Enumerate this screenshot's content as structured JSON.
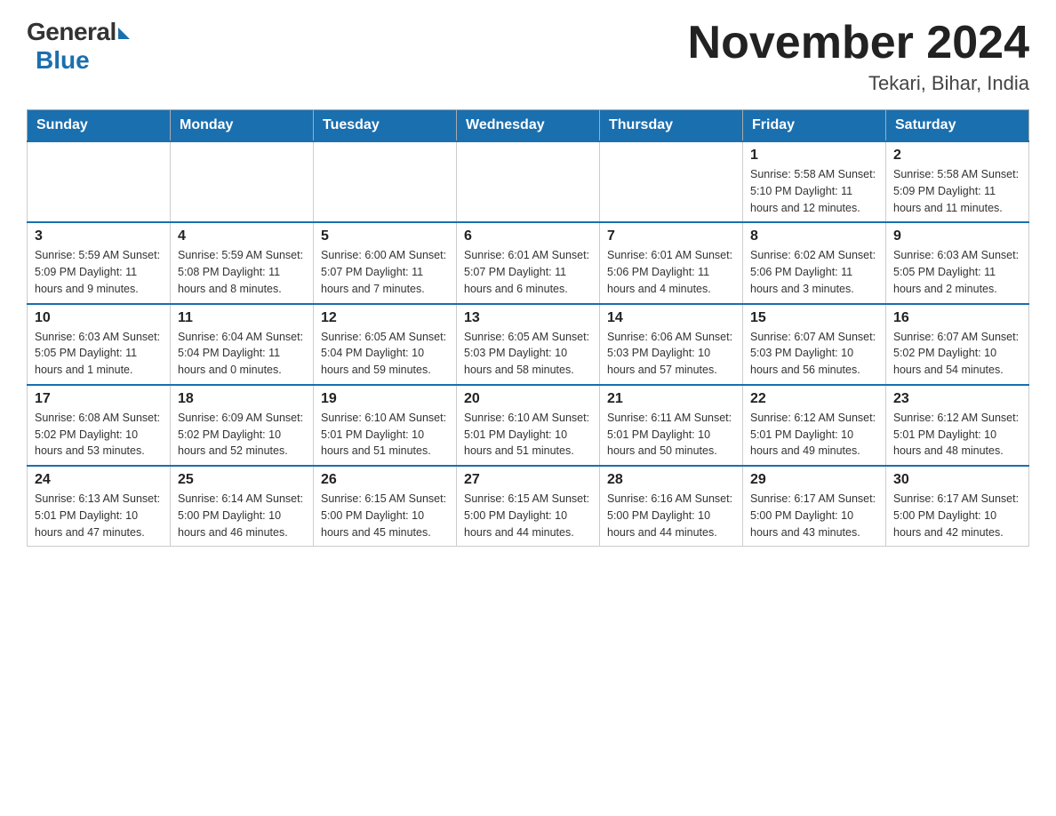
{
  "logo": {
    "general": "General",
    "triangle": "▶",
    "blue": "Blue"
  },
  "title": {
    "month_year": "November 2024",
    "location": "Tekari, Bihar, India"
  },
  "weekdays": [
    "Sunday",
    "Monday",
    "Tuesday",
    "Wednesday",
    "Thursday",
    "Friday",
    "Saturday"
  ],
  "weeks": [
    [
      {
        "day": "",
        "info": ""
      },
      {
        "day": "",
        "info": ""
      },
      {
        "day": "",
        "info": ""
      },
      {
        "day": "",
        "info": ""
      },
      {
        "day": "",
        "info": ""
      },
      {
        "day": "1",
        "info": "Sunrise: 5:58 AM\nSunset: 5:10 PM\nDaylight: 11 hours and 12 minutes."
      },
      {
        "day": "2",
        "info": "Sunrise: 5:58 AM\nSunset: 5:09 PM\nDaylight: 11 hours and 11 minutes."
      }
    ],
    [
      {
        "day": "3",
        "info": "Sunrise: 5:59 AM\nSunset: 5:09 PM\nDaylight: 11 hours and 9 minutes."
      },
      {
        "day": "4",
        "info": "Sunrise: 5:59 AM\nSunset: 5:08 PM\nDaylight: 11 hours and 8 minutes."
      },
      {
        "day": "5",
        "info": "Sunrise: 6:00 AM\nSunset: 5:07 PM\nDaylight: 11 hours and 7 minutes."
      },
      {
        "day": "6",
        "info": "Sunrise: 6:01 AM\nSunset: 5:07 PM\nDaylight: 11 hours and 6 minutes."
      },
      {
        "day": "7",
        "info": "Sunrise: 6:01 AM\nSunset: 5:06 PM\nDaylight: 11 hours and 4 minutes."
      },
      {
        "day": "8",
        "info": "Sunrise: 6:02 AM\nSunset: 5:06 PM\nDaylight: 11 hours and 3 minutes."
      },
      {
        "day": "9",
        "info": "Sunrise: 6:03 AM\nSunset: 5:05 PM\nDaylight: 11 hours and 2 minutes."
      }
    ],
    [
      {
        "day": "10",
        "info": "Sunrise: 6:03 AM\nSunset: 5:05 PM\nDaylight: 11 hours and 1 minute."
      },
      {
        "day": "11",
        "info": "Sunrise: 6:04 AM\nSunset: 5:04 PM\nDaylight: 11 hours and 0 minutes."
      },
      {
        "day": "12",
        "info": "Sunrise: 6:05 AM\nSunset: 5:04 PM\nDaylight: 10 hours and 59 minutes."
      },
      {
        "day": "13",
        "info": "Sunrise: 6:05 AM\nSunset: 5:03 PM\nDaylight: 10 hours and 58 minutes."
      },
      {
        "day": "14",
        "info": "Sunrise: 6:06 AM\nSunset: 5:03 PM\nDaylight: 10 hours and 57 minutes."
      },
      {
        "day": "15",
        "info": "Sunrise: 6:07 AM\nSunset: 5:03 PM\nDaylight: 10 hours and 56 minutes."
      },
      {
        "day": "16",
        "info": "Sunrise: 6:07 AM\nSunset: 5:02 PM\nDaylight: 10 hours and 54 minutes."
      }
    ],
    [
      {
        "day": "17",
        "info": "Sunrise: 6:08 AM\nSunset: 5:02 PM\nDaylight: 10 hours and 53 minutes."
      },
      {
        "day": "18",
        "info": "Sunrise: 6:09 AM\nSunset: 5:02 PM\nDaylight: 10 hours and 52 minutes."
      },
      {
        "day": "19",
        "info": "Sunrise: 6:10 AM\nSunset: 5:01 PM\nDaylight: 10 hours and 51 minutes."
      },
      {
        "day": "20",
        "info": "Sunrise: 6:10 AM\nSunset: 5:01 PM\nDaylight: 10 hours and 51 minutes."
      },
      {
        "day": "21",
        "info": "Sunrise: 6:11 AM\nSunset: 5:01 PM\nDaylight: 10 hours and 50 minutes."
      },
      {
        "day": "22",
        "info": "Sunrise: 6:12 AM\nSunset: 5:01 PM\nDaylight: 10 hours and 49 minutes."
      },
      {
        "day": "23",
        "info": "Sunrise: 6:12 AM\nSunset: 5:01 PM\nDaylight: 10 hours and 48 minutes."
      }
    ],
    [
      {
        "day": "24",
        "info": "Sunrise: 6:13 AM\nSunset: 5:01 PM\nDaylight: 10 hours and 47 minutes."
      },
      {
        "day": "25",
        "info": "Sunrise: 6:14 AM\nSunset: 5:00 PM\nDaylight: 10 hours and 46 minutes."
      },
      {
        "day": "26",
        "info": "Sunrise: 6:15 AM\nSunset: 5:00 PM\nDaylight: 10 hours and 45 minutes."
      },
      {
        "day": "27",
        "info": "Sunrise: 6:15 AM\nSunset: 5:00 PM\nDaylight: 10 hours and 44 minutes."
      },
      {
        "day": "28",
        "info": "Sunrise: 6:16 AM\nSunset: 5:00 PM\nDaylight: 10 hours and 44 minutes."
      },
      {
        "day": "29",
        "info": "Sunrise: 6:17 AM\nSunset: 5:00 PM\nDaylight: 10 hours and 43 minutes."
      },
      {
        "day": "30",
        "info": "Sunrise: 6:17 AM\nSunset: 5:00 PM\nDaylight: 10 hours and 42 minutes."
      }
    ]
  ]
}
